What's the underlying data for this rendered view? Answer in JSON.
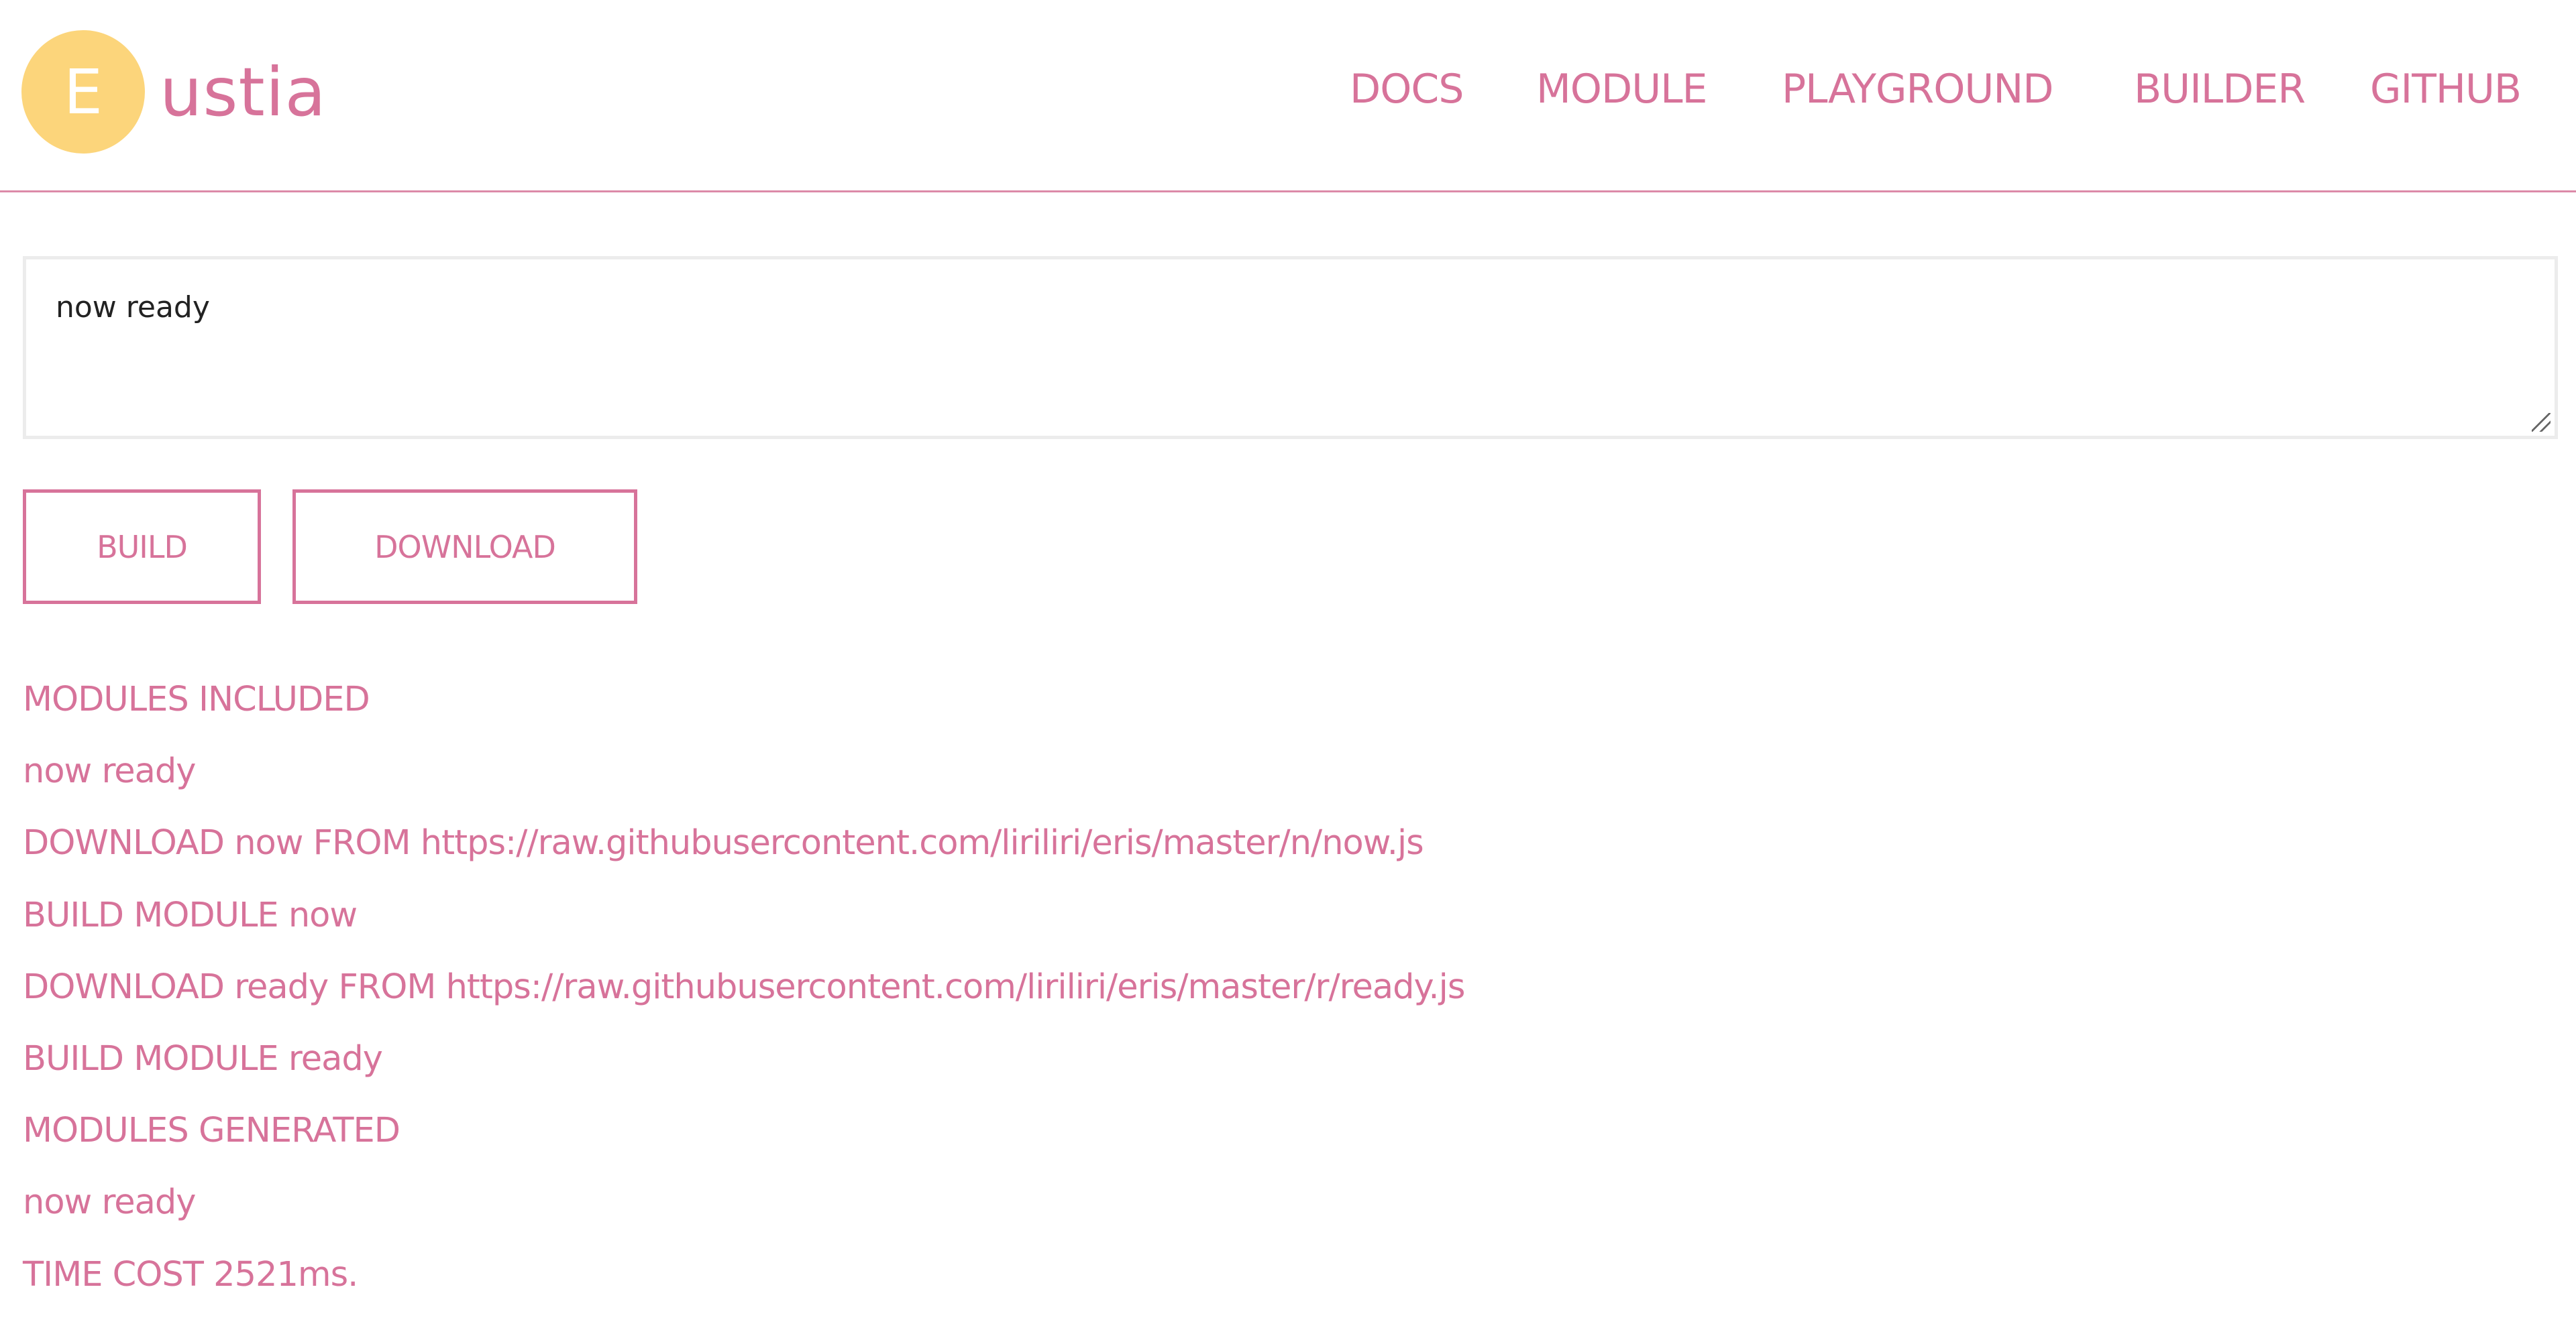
{
  "header": {
    "logo_letter": "E",
    "logo_text": "ustia",
    "nav": [
      {
        "label": "DOCS"
      },
      {
        "label": "MODULE"
      },
      {
        "label": "PLAYGROUND"
      },
      {
        "label": "BUILDER"
      },
      {
        "label": "GITHUB"
      }
    ]
  },
  "editor": {
    "value": "now ready"
  },
  "buttons": {
    "build_label": "BUILD",
    "download_label": "DOWNLOAD"
  },
  "log": [
    "MODULES INCLUDED",
    "now ready",
    "DOWNLOAD now FROM https://raw.githubusercontent.com/liriliri/eris/master/n/now.js",
    "BUILD MODULE now",
    "DOWNLOAD ready FROM https://raw.githubusercontent.com/liriliri/eris/master/r/ready.js",
    "BUILD MODULE ready",
    "MODULES GENERATED",
    "now ready",
    "TIME COST 2521ms."
  ],
  "colors": {
    "accent": "#d7739a",
    "logo_circle": "#fcd57b",
    "editor_border": "#ececec"
  }
}
